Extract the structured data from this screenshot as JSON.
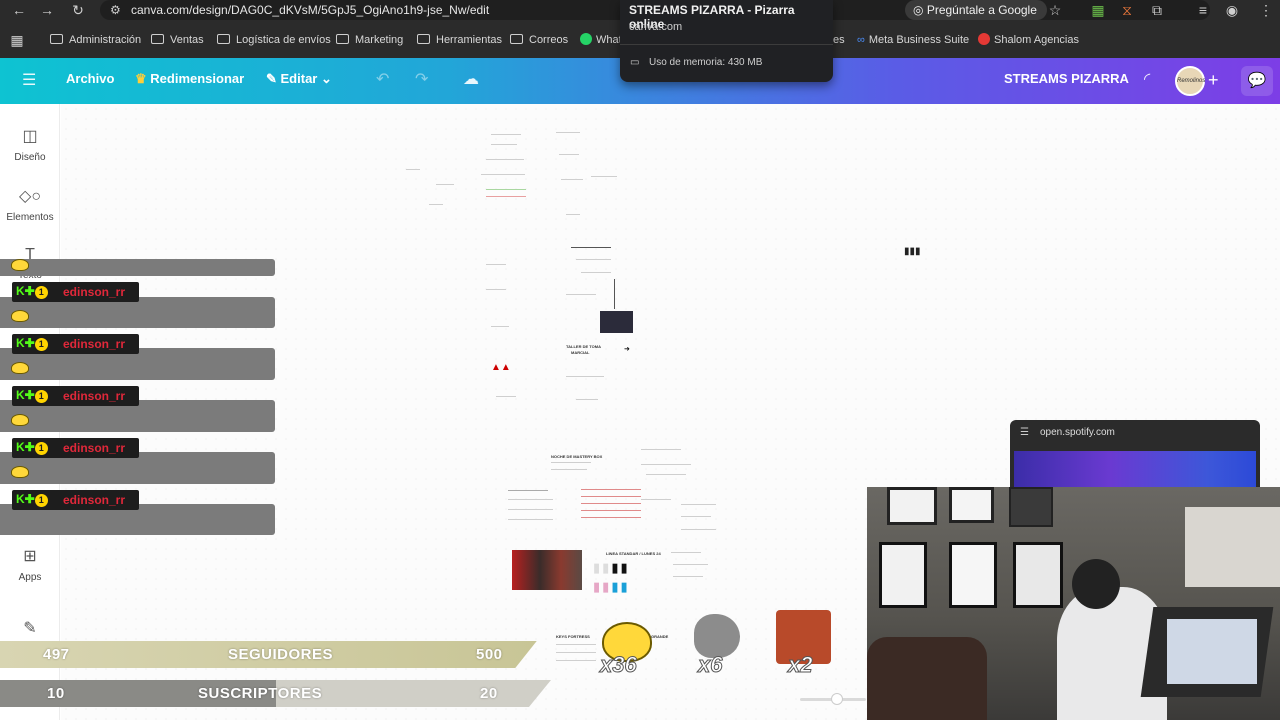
{
  "browser": {
    "url": "canva.com/design/DAG0C_dKVsM/5GpJ5_OgiAno1h9-jse_Nw/edit",
    "ask_google": "Pregúntale a Google",
    "bookmarks": [
      "Administración",
      "Ventas",
      "Logística de envíos",
      "Marketing",
      "Herramientas",
      "Correos",
      "What",
      "es",
      "Meta Business Suite",
      "Shalom Agencias"
    ],
    "tab_tooltip": {
      "title": "STREAMS PIZARRA - Pizarra online",
      "domain": "canva.com",
      "memory": "Uso de memoria: 430 MB"
    }
  },
  "canva_header": {
    "archivo": "Archivo",
    "redimensionar": "Redimensionar",
    "editar": "Editar",
    "project_title": "STREAMS PIZARRA",
    "avatar_text": "Remolinos"
  },
  "sidebar": {
    "items": [
      "Diseño",
      "Elementos",
      "Texto",
      "Apps"
    ]
  },
  "canvas": {
    "text_1": "NOCHE DE MASTERY BOX",
    "text_2": "TALLER DE TOMA",
    "text_3": "MARCIAL",
    "text_4": "LINEA STANDAR / LUNES 24",
    "text_5": "KEYS FORTRESS",
    "text_6": "GRANDE"
  },
  "chat": {
    "username": "edinson_rr",
    "badge_count": "1",
    "badge_letter": "K"
  },
  "goals": {
    "followers_current": "497",
    "followers_label": "SEGUIDORES",
    "followers_target": "500",
    "followers_progress": 0.994,
    "subs_current": "10",
    "subs_label": "SUSCRIPTORES",
    "subs_target": "20",
    "subs_progress": 0.5
  },
  "reactions": [
    {
      "name": "pikachu",
      "count": "x36"
    },
    {
      "name": "fish",
      "count": "x6"
    },
    {
      "name": "laughing-man",
      "count": "x2"
    }
  ],
  "spotify": {
    "domain": "open.spotify.com"
  },
  "colors": {
    "header_start": "#0ec3d2",
    "header_end": "#7d3ee6",
    "chat_bar": "#7b7b7b",
    "username": "#e0283a",
    "kick_green": "#53fc18"
  }
}
